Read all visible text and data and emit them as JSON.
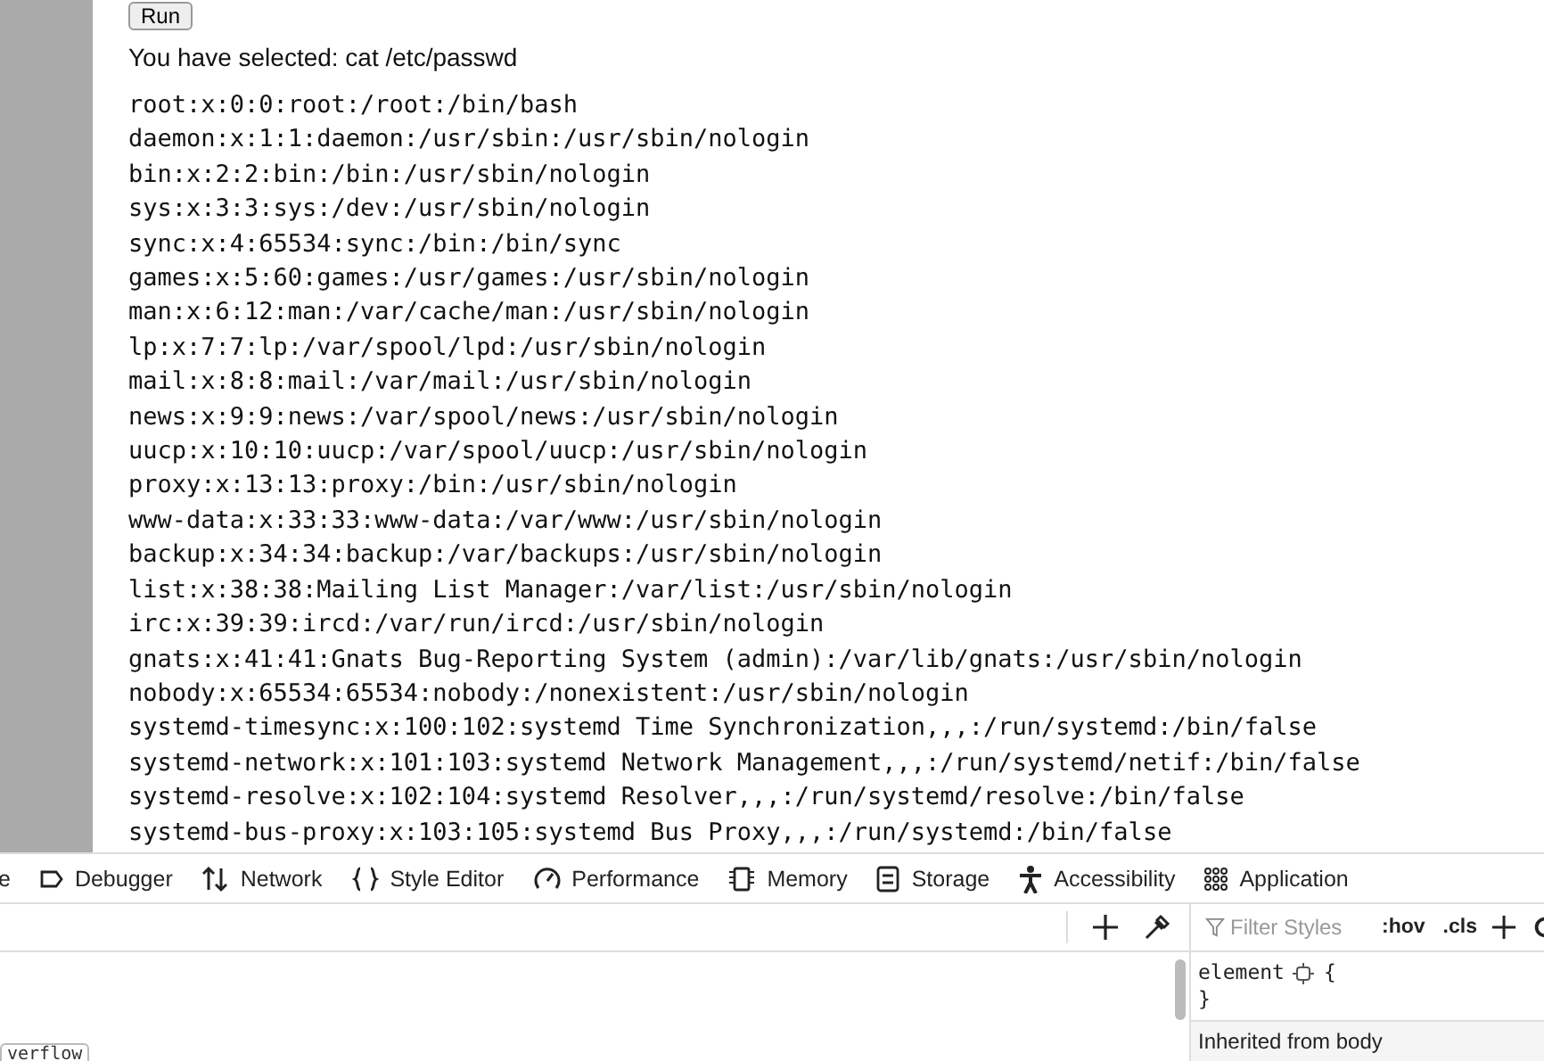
{
  "page": {
    "run_button": "Run",
    "selection_message": "You have selected: cat /etc/passwd",
    "output_lines": [
      "root:x:0:0:root:/root:/bin/bash",
      "daemon:x:1:1:daemon:/usr/sbin:/usr/sbin/nologin",
      "bin:x:2:2:bin:/bin:/usr/sbin/nologin",
      "sys:x:3:3:sys:/dev:/usr/sbin/nologin",
      "sync:x:4:65534:sync:/bin:/bin/sync",
      "games:x:5:60:games:/usr/games:/usr/sbin/nologin",
      "man:x:6:12:man:/var/cache/man:/usr/sbin/nologin",
      "lp:x:7:7:lp:/var/spool/lpd:/usr/sbin/nologin",
      "mail:x:8:8:mail:/var/mail:/usr/sbin/nologin",
      "news:x:9:9:news:/var/spool/news:/usr/sbin/nologin",
      "uucp:x:10:10:uucp:/var/spool/uucp:/usr/sbin/nologin",
      "proxy:x:13:13:proxy:/bin:/usr/sbin/nologin",
      "www-data:x:33:33:www-data:/var/www:/usr/sbin/nologin",
      "backup:x:34:34:backup:/var/backups:/usr/sbin/nologin",
      "list:x:38:38:Mailing List Manager:/var/list:/usr/sbin/nologin",
      "irc:x:39:39:ircd:/var/run/ircd:/usr/sbin/nologin",
      "gnats:x:41:41:Gnats Bug-Reporting System (admin):/var/lib/gnats:/usr/sbin/nologin",
      "nobody:x:65534:65534:nobody:/nonexistent:/usr/sbin/nologin",
      "systemd-timesync:x:100:102:systemd Time Synchronization,,,:/run/systemd:/bin/false",
      "systemd-network:x:101:103:systemd Network Management,,,:/run/systemd/netif:/bin/false",
      "systemd-resolve:x:102:104:systemd Resolver,,,:/run/systemd/resolve:/bin/false",
      "systemd-bus-proxy:x:103:105:systemd Bus Proxy,,,:/run/systemd:/bin/false"
    ]
  },
  "devtools": {
    "tabs": [
      {
        "label": "e"
      },
      {
        "label": "Debugger"
      },
      {
        "label": "Network"
      },
      {
        "label": "Style Editor"
      },
      {
        "label": "Performance"
      },
      {
        "label": "Memory"
      },
      {
        "label": "Storage"
      },
      {
        "label": "Accessibility"
      },
      {
        "label": "Application"
      }
    ],
    "markup_badge": "verflow",
    "styles": {
      "filter_placeholder": "Filter Styles",
      "hov": ":hov",
      "cls": ".cls",
      "rule_selector": "element",
      "open_brace": "{",
      "close_brace": "}",
      "inherited": "Inherited from body"
    }
  }
}
